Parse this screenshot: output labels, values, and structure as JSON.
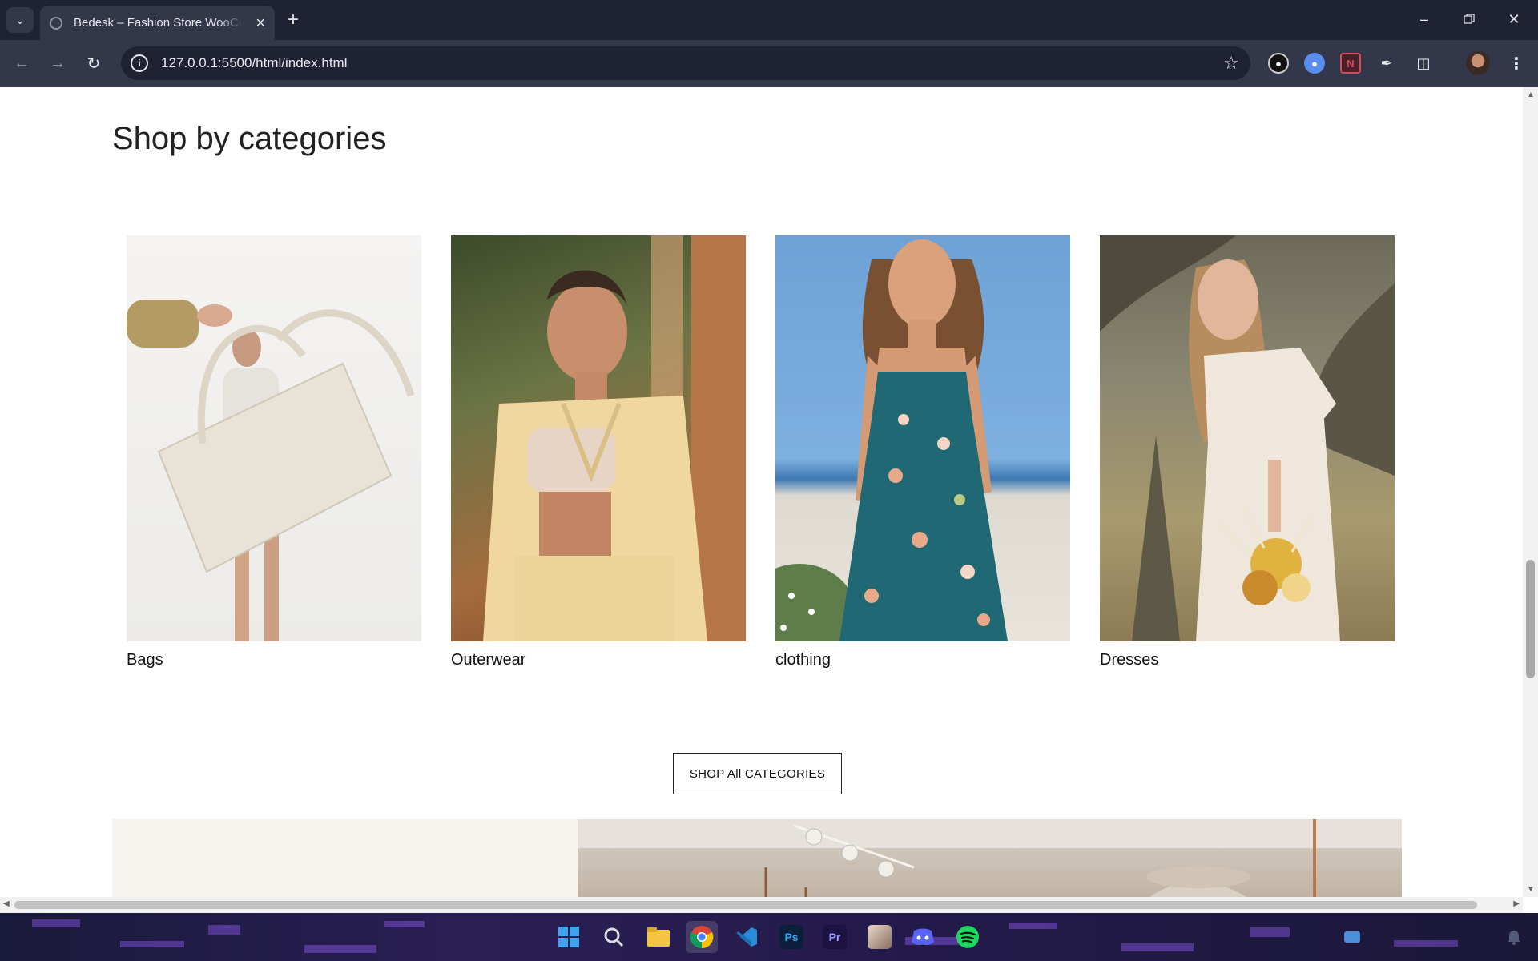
{
  "browser": {
    "tab_title": "Bedesk – Fashion Store WooCommerce",
    "url": "127.0.0.1:5500/html/index.html"
  },
  "page": {
    "section_title": "Shop by categories",
    "categories": [
      {
        "label": "Bags"
      },
      {
        "label": "Outerwear"
      },
      {
        "label": "clothing"
      },
      {
        "label": "Dresses"
      }
    ],
    "shop_all_label": "SHOP All CATEGORIES"
  },
  "taskbar": {
    "apps": [
      "start",
      "search",
      "file-explorer",
      "chrome",
      "vscode",
      "photoshop",
      "premiere",
      "app-avatar",
      "discord",
      "spotify"
    ]
  }
}
